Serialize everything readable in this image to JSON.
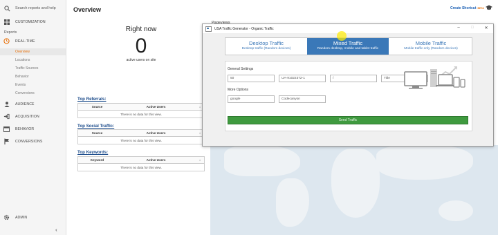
{
  "sidebar": {
    "search_placeholder": "Search reports and help",
    "customization": "CUSTOMIZATION",
    "reports_label": "Reports",
    "realtime": "REAL-TIME",
    "realtime_items": [
      "Overview",
      "Locations",
      "Traffic Sources",
      "Behavior",
      "Events",
      "Conversions"
    ],
    "audience": "AUDIENCE",
    "acquisition": "ACQUISITION",
    "behavior": "BEHAVIOR",
    "conversions": "CONVERSIONS",
    "admin": "ADMIN",
    "collapse": "‹"
  },
  "header": {
    "title": "Overview",
    "shortcut": "Create Shortcut",
    "shortcut_badge": "BETA"
  },
  "realtime": {
    "right_now": "Right now",
    "active_count": "0",
    "active_label": "active users on site",
    "pageviews_label": "Pageviews"
  },
  "panels": {
    "referrals": {
      "title": "Top Referrals:",
      "col1": "Source",
      "col2": "Active Users",
      "empty": "There is no data for this view."
    },
    "social": {
      "title": "Top Social Traffic:",
      "col1": "Source",
      "col2": "Active Users",
      "empty": "There is no data for this view."
    },
    "keywords": {
      "title": "Top Keywords:",
      "col1": "Keyword",
      "col2": "Active Users",
      "empty": "There is no data for this view."
    }
  },
  "dialog": {
    "title": "USA Traffic Generator - Organic Traffic",
    "tabs": [
      {
        "title": "Desktop Traffic",
        "subtitle": "Desktop traffic (Random devices)"
      },
      {
        "title": "Mixed Traffic",
        "subtitle": "Random desktop, mobile and tablet traffic"
      },
      {
        "title": "Mobile Traffic",
        "subtitle": "Mobile traffic only (Random devices)"
      }
    ],
    "general_label": "General Settings",
    "general_fields": [
      "50",
      "UA-91022372-1",
      "/",
      "Title"
    ],
    "more_label": "More Options",
    "more_fields": [
      "google",
      "Codecanyon"
    ],
    "send_button": "Send Traffic"
  },
  "colors": {
    "accent": "#e8710a",
    "link": "#1a4a8a",
    "tab_active": "#3a78b8",
    "send_button": "#3f9a3f"
  }
}
